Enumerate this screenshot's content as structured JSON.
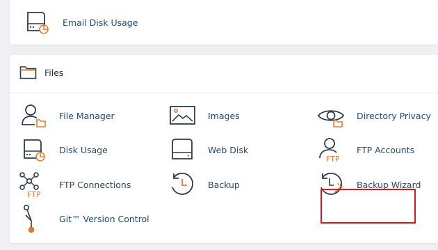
{
  "email_panel": {
    "items": [
      {
        "label": "Email Disk Usage",
        "icon": "disk-chart-icon"
      }
    ]
  },
  "files_panel": {
    "title": "Files",
    "title_icon": "folder-icon",
    "items": [
      {
        "label": "File Manager",
        "icon": "user-folder-icon"
      },
      {
        "label": "Images",
        "icon": "image-icon"
      },
      {
        "label": "Directory Privacy",
        "icon": "eye-folder-icon"
      },
      {
        "label": "Disk Usage",
        "icon": "disk-chart-icon"
      },
      {
        "label": "Web Disk",
        "icon": "web-disk-icon"
      },
      {
        "label": "FTP Accounts",
        "icon": "ftp-user-icon"
      },
      {
        "label": "FTP Connections",
        "icon": "ftp-network-icon"
      },
      {
        "label": "Backup",
        "icon": "backup-clock-icon"
      },
      {
        "label": "Backup Wizard",
        "icon": "backup-wizard-icon"
      },
      {
        "label": "Git™ Version Control",
        "icon": "git-branch-icon"
      }
    ],
    "ftp_icon_text": "FTP",
    "highlighted_item": "FTP Accounts"
  },
  "colors": {
    "accent_orange": "#f07a28",
    "icon_stroke": "#2b3b4b",
    "label_blue": "#25486b",
    "highlight_red": "#e0141b"
  }
}
